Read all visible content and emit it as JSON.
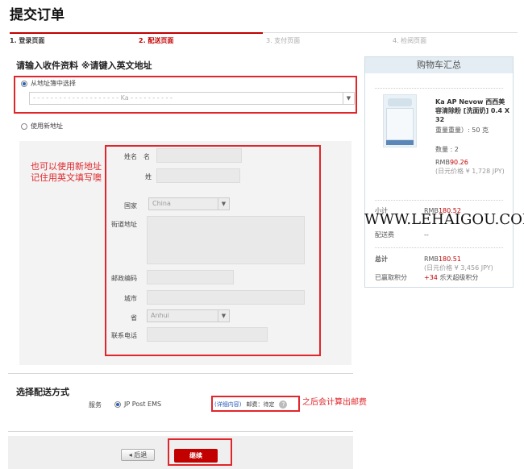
{
  "header": {
    "title": "提交订单"
  },
  "steps": [
    {
      "label": "1. 登录页面",
      "state": "done"
    },
    {
      "label": "2. 配送页面",
      "state": "active"
    },
    {
      "label": "3. 支付页面",
      "state": "pending"
    },
    {
      "label": "4. 检阅页面",
      "state": "pending"
    }
  ],
  "address": {
    "section_title": "请输入收件资料 ※请键入英文地址",
    "option_book": "从地址簿中选择",
    "book_selected": "- - - - - - - - - - - - - - - - - - - - Ka - - - - - - - - - -",
    "option_new": "使用新地址"
  },
  "annotation_left": {
    "line1": "也可以使用新地址",
    "line2": "记住用英文填写噢"
  },
  "form": {
    "name_label": "姓名",
    "first_name_label": "名",
    "last_name_label": "姓",
    "country_label": "国家",
    "country_value": "China",
    "street_label": "街道地址",
    "zip_label": "邮政编码",
    "city_label": "城市",
    "province_label": "省",
    "province_value": "Anhui",
    "phone_label": "联系电话"
  },
  "cart": {
    "title": "购物车汇总",
    "product_name": "Ka AP Nevow 西西美容清除粉 [洗面奶] 0.4 X 32",
    "product_weight": "重量重量）: 50 克",
    "quantity": "数量 : 2",
    "price_prefix": "RMB",
    "price_value": "90.26",
    "price_jpy": "(日元价格 ¥ 1,728 JPY)",
    "subtotal_label": "小计",
    "subtotal_prefix": "RMB",
    "subtotal_value": "180.52",
    "shipping_label": "配送费",
    "shipping_value": "--",
    "total_label": "总计",
    "total_prefix": "RMB",
    "total_value": "180.51",
    "total_jpy": "(日元价格 ¥ 3,456 JPY)",
    "points_label": "已赢取积分",
    "points_value": "+34",
    "points_suffix": "乐天超级积分"
  },
  "watermark": "WWW.LEHAIGOU.COM",
  "shipping": {
    "section_title": "选择配送方式",
    "service_label": "服务",
    "service_name": "JP Post EMS",
    "details_link": "(详细内容)",
    "fee_text": "邮费：待定",
    "qmark": "?",
    "note": "之后会计算出邮费"
  },
  "buttons": {
    "back_arrow": "◂",
    "back": "后退",
    "next": "继续"
  },
  "colors": {
    "accent_red": "#c30000",
    "annotation_red": "#e0262b",
    "cart_head": "#e3edf3"
  }
}
